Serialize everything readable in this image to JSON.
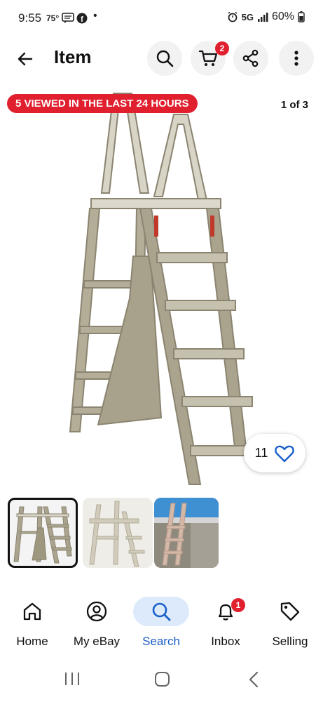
{
  "status_bar": {
    "time": "9:55",
    "temp": "75°",
    "network": "5G",
    "battery": "60%"
  },
  "app_bar": {
    "title": "Item",
    "cart_count": "2"
  },
  "banner": {
    "text": "5 VIEWED IN THE LAST 24 HOURS"
  },
  "gallery": {
    "counter": "1 of 3",
    "watch_count": "11"
  },
  "bottom_nav": [
    {
      "label": "Home",
      "icon": "home-icon"
    },
    {
      "label": "My eBay",
      "icon": "user-icon"
    },
    {
      "label": "Search",
      "icon": "search-icon",
      "active": true
    },
    {
      "label": "Inbox",
      "icon": "bell-icon",
      "badge": "1"
    },
    {
      "label": "Selling",
      "icon": "tag-icon"
    }
  ],
  "colors": {
    "accent_red": "#e0202f",
    "accent_blue": "#1a5fc9",
    "active_pill": "#dceafb"
  }
}
